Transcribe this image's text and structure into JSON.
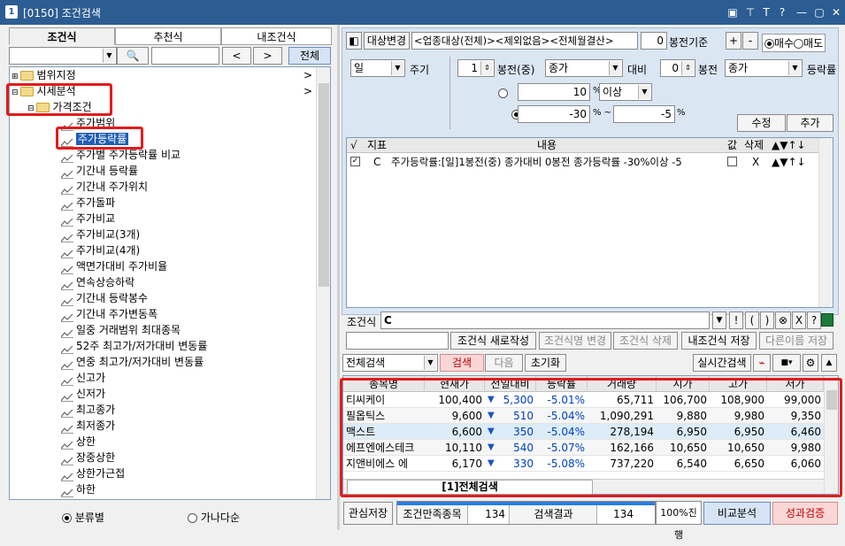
{
  "window": {
    "id": "1",
    "title": "[0150] 조건검색",
    "controls": [
      "▣",
      "⊤",
      "T",
      "?",
      "—",
      "▢",
      "✕"
    ]
  },
  "left": {
    "tabs": [
      "조건식",
      "추천식",
      "내조건식"
    ],
    "search_btn": "전체",
    "nav_prev": "<",
    "nav_next": ">",
    "tree": [
      {
        "label": "범위지정",
        "type": "folder",
        "level": 0,
        "arrow": ">"
      },
      {
        "label": "시세분석",
        "type": "folder",
        "level": 0,
        "arrow": ">"
      },
      {
        "label": "가격조건",
        "type": "folder",
        "level": 1
      },
      {
        "label": "주가범위",
        "type": "item"
      },
      {
        "label": "주가등락률",
        "type": "item",
        "selected": true
      },
      {
        "label": "주가별 주가등락률 비교",
        "type": "item"
      },
      {
        "label": "기간내 등락률",
        "type": "item"
      },
      {
        "label": "기간내 주가위치",
        "type": "item"
      },
      {
        "label": "주가돌파",
        "type": "item"
      },
      {
        "label": "주가비교",
        "type": "item"
      },
      {
        "label": "주가비교(3개)",
        "type": "item"
      },
      {
        "label": "주가비교(4개)",
        "type": "item"
      },
      {
        "label": "액면가대비 주가비율",
        "type": "item"
      },
      {
        "label": "연속상승하락",
        "type": "item"
      },
      {
        "label": "기간내 등락봉수",
        "type": "item"
      },
      {
        "label": "기간내 주가변동폭",
        "type": "item"
      },
      {
        "label": "일중 거래범위 최대종목",
        "type": "item"
      },
      {
        "label": "52주 최고가/저가대비 변동률",
        "type": "item"
      },
      {
        "label": "연중 최고가/저가대비 변동률",
        "type": "item"
      },
      {
        "label": "신고가",
        "type": "item"
      },
      {
        "label": "신저가",
        "type": "item"
      },
      {
        "label": "최고종가",
        "type": "item"
      },
      {
        "label": "최저종가",
        "type": "item"
      },
      {
        "label": "상한",
        "type": "item"
      },
      {
        "label": "장중상한",
        "type": "item"
      },
      {
        "label": "상한가근접",
        "type": "item"
      },
      {
        "label": "하한",
        "type": "item"
      }
    ],
    "radio": [
      {
        "label": "분류별",
        "on": true
      },
      {
        "label": "가나다순",
        "on": false
      }
    ]
  },
  "right": {
    "target_btn": "대상변경",
    "target_text": "<업종대상(전체)><제외없음><전체월결산>",
    "base_value": "0",
    "base_label": "봉전기준",
    "plus": "+",
    "minus": "-",
    "trade_radio": [
      {
        "label": "매수",
        "on": true
      },
      {
        "label": "매도",
        "on": false
      }
    ],
    "period": "일",
    "period_label": "주기",
    "bong1": "1",
    "bong1_label": "봉전(중)",
    "price1": "종가",
    "vs_label": "대비",
    "bong2": "0",
    "bong2_label": "봉전",
    "price2": "종가",
    "rate_label": "등락률",
    "opt1_val": "10",
    "opt1_unit": "%",
    "opt1_cmp": "이상",
    "opt2_from": "-30",
    "opt2_unit": "% ~",
    "opt2_to": "-5",
    "opt2_unit2": "%",
    "edit_btn": "수정",
    "add_btn": "추가",
    "cond_headers": [
      "√",
      "지표",
      "내용",
      "값",
      "삭제",
      "▲▼↑↓"
    ],
    "cond_row": {
      "checked": "✓",
      "id": "C",
      "content": "주가등락률:[일]1봉전(중) 종가대비 0봉전 종가등락률 -30%이상 -5",
      "del": "X",
      "moves": "▲▼↑↓"
    },
    "formula_label": "조건식",
    "formula_value": "C",
    "formula_ops": [
      "▼",
      "!",
      "(",
      ")",
      "⊗",
      "X",
      "?"
    ],
    "new_btn": "조건식 새로작성",
    "rename_btn": "조건식명 변경",
    "del_btn": "조건식 삭제",
    "save_btn": "내조건식 저장",
    "saveas_btn": "다른이름 저장",
    "search_scope": "전체검색",
    "search_btn": "검색",
    "next_btn": "다음",
    "reset_btn": "초기화",
    "realtime_btn": "실시간검색"
  },
  "results": {
    "headers": [
      "종목명",
      "현재가",
      "전일대비",
      "등락률",
      "거래량",
      "시가",
      "고가",
      "저가"
    ],
    "rows": [
      {
        "name": "티씨케이",
        "price": "100,400",
        "diff": "5,300",
        "rate": "-5.01%",
        "vol": "65,711",
        "open": "106,700",
        "high": "108,900",
        "low": "99,000"
      },
      {
        "name": "필옵틱스",
        "price": "9,600",
        "diff": "510",
        "rate": "-5.04%",
        "vol": "1,090,291",
        "open": "9,880",
        "high": "9,980",
        "low": "9,350"
      },
      {
        "name": "맥스트",
        "price": "6,600",
        "diff": "350",
        "rate": "-5.04%",
        "vol": "278,194",
        "open": "6,950",
        "high": "6,950",
        "low": "6,460"
      },
      {
        "name": "에프엔에스테크",
        "price": "10,110",
        "diff": "540",
        "rate": "-5.07%",
        "vol": "162,166",
        "open": "10,650",
        "high": "10,650",
        "low": "9,980"
      },
      {
        "name": "지앤비에스 에",
        "price": "6,170",
        "diff": "330",
        "rate": "-5.08%",
        "vol": "737,220",
        "open": "6,540",
        "high": "6,650",
        "low": "6,060"
      }
    ],
    "footer_tab": "[1]전체검색"
  },
  "bottom": {
    "save_btn": "관심저장",
    "match_label": "조건만족종목",
    "match_val": "134",
    "result_label": "검색결과",
    "result_val": "134",
    "progress": "100%진행",
    "progress_fraction": 1.0,
    "compare_btn": "비교분석",
    "perf_btn": "성과검증"
  }
}
